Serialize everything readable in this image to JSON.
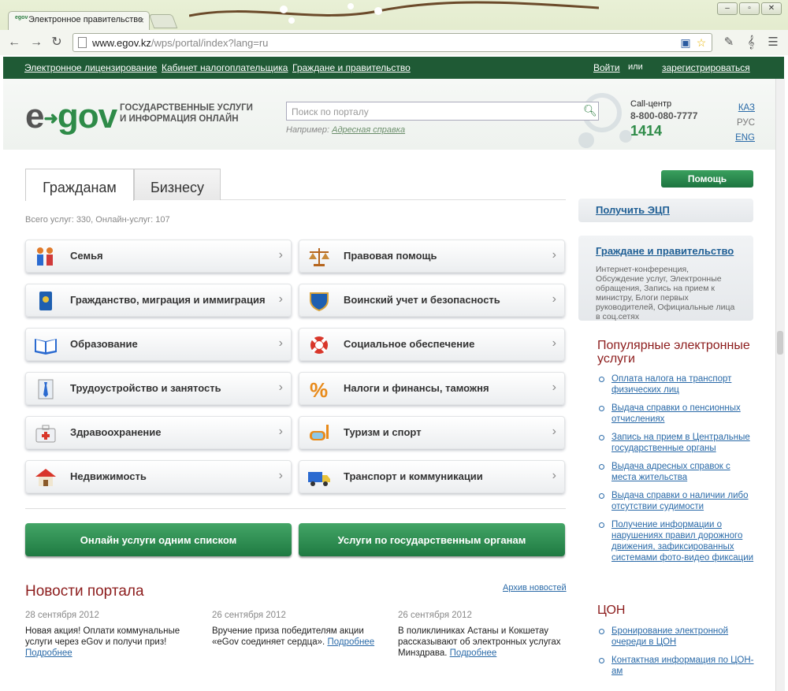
{
  "browser": {
    "tab_title": "Электронное правительство",
    "tab_favicon": "egov",
    "url_host": "www.egov.kz",
    "url_path": "/wps/portal/index?lang=ru",
    "icons": [
      "back-icon",
      "forward-icon",
      "reload-icon",
      "page-icon",
      "star-icon",
      "wrench-icon"
    ]
  },
  "topnav": {
    "links": [
      "Электронное лицензирование",
      "Кабинет налогоплательщика",
      "Граждане и правительство"
    ],
    "login": "Войти",
    "or": "или",
    "register": "зарегистрироваться"
  },
  "header": {
    "logo_e": "e",
    "logo_gov": "gov",
    "tagline": "Государственные услуги и информация онлайн",
    "search_placeholder": "Поиск по порталу",
    "example_label": "Например:",
    "example_link": "Адресная справка",
    "call_label": "Call-центр",
    "call_phone": "8-800-080-7777",
    "call_short": "1414",
    "langs": [
      "КАЗ",
      "РУС",
      "ENG"
    ]
  },
  "tabs": [
    "Гражданам",
    "Бизнесу"
  ],
  "counts": "Всего услуг: 330, Онлайн-услуг: 107",
  "categories": [
    {
      "label": "Семья",
      "icon": "family-icon"
    },
    {
      "label": "Правовая помощь",
      "icon": "scales-icon"
    },
    {
      "label": "Гражданство, миграция и иммиграция",
      "icon": "passport-icon"
    },
    {
      "label": "Воинский учет и безопасность",
      "icon": "shield-icon"
    },
    {
      "label": "Образование",
      "icon": "book-icon"
    },
    {
      "label": "Социальное обеспечение",
      "icon": "lifebuoy-icon"
    },
    {
      "label": "Трудоустройство и занятость",
      "icon": "tie-icon"
    },
    {
      "label": "Налоги и финансы, таможня",
      "icon": "percent-icon"
    },
    {
      "label": "Здравоохранение",
      "icon": "medkit-icon"
    },
    {
      "label": "Туризм и спорт",
      "icon": "diving-mask-icon"
    },
    {
      "label": "Недвижимость",
      "icon": "house-icon"
    },
    {
      "label": "Транспорт и коммуникации",
      "icon": "truck-icon"
    }
  ],
  "buttons": {
    "online_list": "Онлайн услуги одним списком",
    "by_agency": "Услуги по государственным органам"
  },
  "news": {
    "title": "Новости портала",
    "archive": "Архив новостей",
    "more": "Подробнее",
    "items": [
      {
        "date": "28 сентября 2012",
        "text": "Новая акция! Оплати коммунальные услуги через eGov и получи приз!"
      },
      {
        "date": "26 сентября 2012",
        "text": "Вручение приза победителям акции «eGov соединяет сердца»."
      },
      {
        "date": "26 сентября 2012",
        "text": "В поликлиниках Астаны и Кокшетау рассказывают об электронных услугах Минздрава."
      }
    ]
  },
  "sidebar": {
    "help": "Помощь",
    "ecp": "Получить ЭЦП",
    "gov_title": "Граждане и правительство",
    "gov_desc": "Интернет-конференция, Обсуждение услуг, Электронные обращения, Запись на прием к министру, Блоги первых руководителей, Официальные лица в соц.сетях",
    "popular_title": "Популярные электронные услуги",
    "popular": [
      "Оплата налога на транспорт физических лиц",
      "Выдача справки о пенсионных отчислениях",
      "Запись на прием в Центральные государственные органы",
      "Выдача адресных справок с места жительства",
      "Выдача справки о наличии либо отсутствии судимости",
      "Получение информации о нарушениях правил дорожного движения, зафиксированных системами фото-видео фиксации"
    ],
    "con_title": "ЦОН",
    "con": [
      "Бронирование электронной очереди в ЦОН",
      "Контактная информация по ЦОН-ам"
    ]
  },
  "colors": {
    "brand_green": "#1f5a35",
    "accent_red": "#8c1c1c",
    "link_blue": "#2a6aa8"
  }
}
